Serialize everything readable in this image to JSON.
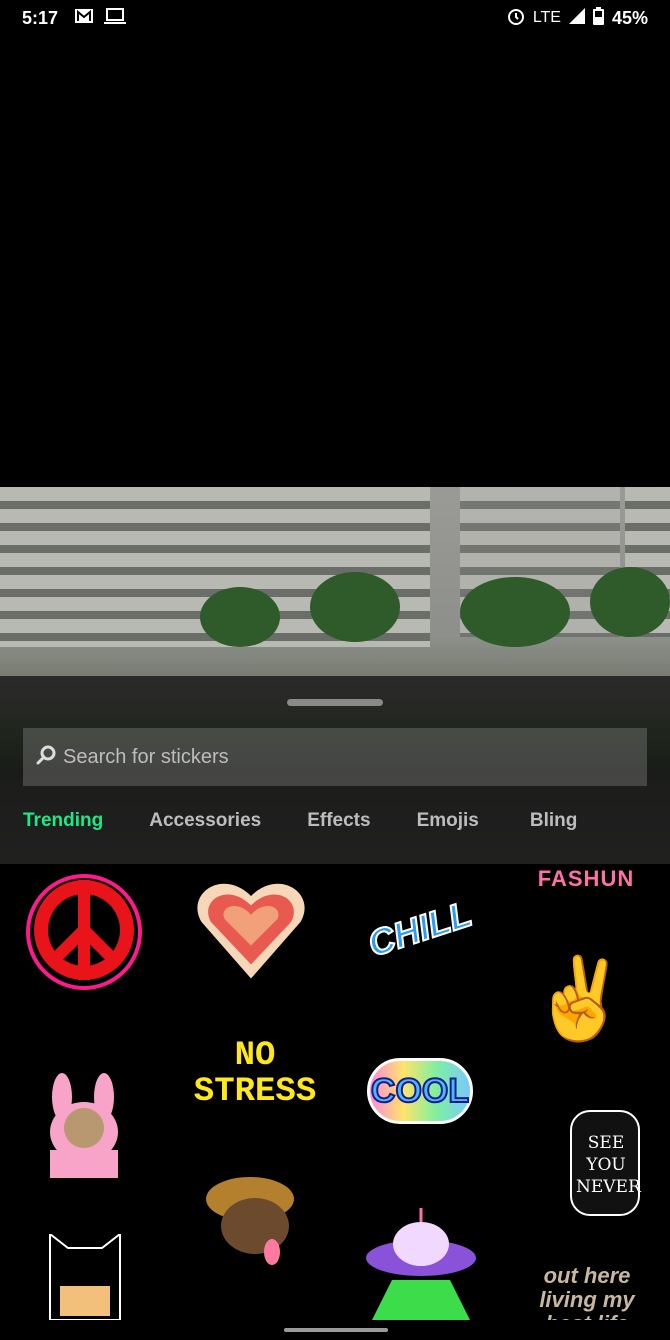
{
  "status_bar": {
    "time": "5:17",
    "network": "LTE",
    "battery": "45%",
    "icons": [
      "gmail-icon",
      "laptop-icon",
      "alarm-icon",
      "signal-icon",
      "battery-icon"
    ]
  },
  "search": {
    "placeholder": "Search for stickers",
    "value": ""
  },
  "tabs": [
    {
      "label": "Trending",
      "active": true
    },
    {
      "label": "Accessories"
    },
    {
      "label": "Effects"
    },
    {
      "label": "Emojis"
    },
    {
      "label": "Bling"
    }
  ],
  "colors": {
    "active_tab": "#1de986",
    "inactive_tab": "#bdbdbd"
  },
  "stickers": {
    "chill": "CHILL",
    "fashun": "FASHUN",
    "no_stress": "NO STRESS",
    "cool": "COOL",
    "see_you_never": "SEE YOU NEVER",
    "living": "out here living my best life"
  }
}
